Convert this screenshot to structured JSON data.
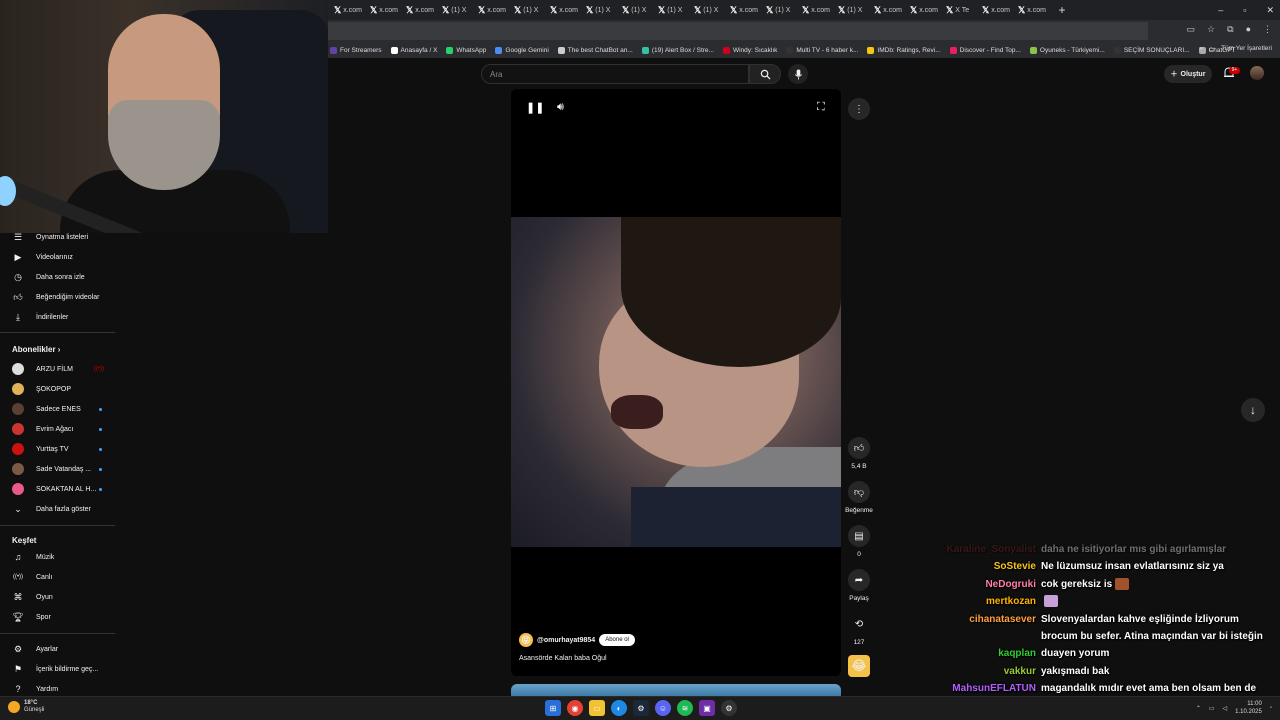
{
  "browser": {
    "tabs": [
      "x.com",
      "x.com",
      "x.com",
      "(1) X",
      "x.com",
      "(1) X",
      "x.com",
      "(1) X",
      "(1) X",
      "(1) X",
      "(1) X",
      "x.com",
      "(1) X",
      "x.com",
      "(1) X",
      "x.com",
      "x.com",
      "X Te",
      "x.com",
      "x.com"
    ],
    "new_tab": "+",
    "bookmarks": [
      {
        "label": "For Streamers",
        "color": "#6441a5"
      },
      {
        "label": "Anasayfa / X",
        "color": "#ffffff"
      },
      {
        "label": "WhatsApp",
        "color": "#25d366"
      },
      {
        "label": "Google Gemini",
        "color": "#4d8bf5"
      },
      {
        "label": "The best ChatBot an...",
        "color": "#cccccc"
      },
      {
        "label": "(19) Alert Box / Stre...",
        "color": "#31c3a2"
      },
      {
        "label": "Windy: Sıcaklık",
        "color": "#d0021b"
      },
      {
        "label": "Multi TV - 6 haber k...",
        "color": "#333333"
      },
      {
        "label": "IMDb: Ratings, Revi...",
        "color": "#f5c518"
      },
      {
        "label": "Discover - Find Top...",
        "color": "#e91e63"
      },
      {
        "label": "Oyuneks - Türkiyemi...",
        "color": "#8bc34a"
      },
      {
        "label": "SEÇİM SONUÇLARI...",
        "color": "#333333"
      },
      {
        "label": "ChatGPT",
        "color": "#aaaaaa"
      }
    ],
    "bookmarks_overflow": "»",
    "all_bookmarks": "Tüm Yer İşaretleri"
  },
  "sidebar": {
    "you_items": [
      {
        "label": "Oynatma listeleri",
        "icon": "playlist-icon"
      },
      {
        "label": "Videolarınız",
        "icon": "video-icon"
      },
      {
        "label": "Daha sonra izle",
        "icon": "clock-icon"
      },
      {
        "label": "Beğendiğim videolar",
        "icon": "thumbs-up-icon"
      },
      {
        "label": "İndirilenler",
        "icon": "download-icon"
      }
    ],
    "subs_title": "Abonelikler",
    "subscriptions": [
      {
        "label": "ARZU FİLM",
        "color": "#dddddd",
        "indicator": "live"
      },
      {
        "label": "ŞOKOPOP",
        "color": "#e0b25a",
        "indicator": "none"
      },
      {
        "label": "Sadece ENES",
        "color": "#5a4030",
        "indicator": "dot"
      },
      {
        "label": "Evrim Ağacı",
        "color": "#cc3333",
        "indicator": "dot"
      },
      {
        "label": "Yurttaş TV",
        "color": "#cc1111",
        "indicator": "dot"
      },
      {
        "label": "Sade Vatandaş ...",
        "color": "#7a5a44",
        "indicator": "dot"
      },
      {
        "label": "SOKAKTAN AL H...",
        "color": "#e85a8a",
        "indicator": "dot"
      }
    ],
    "show_more": "Daha fazla göster",
    "explore_title": "Keşfet",
    "explore_items": [
      {
        "label": "Müzik",
        "icon": "music-icon"
      },
      {
        "label": "Canlı",
        "icon": "live-icon"
      },
      {
        "label": "Oyun",
        "icon": "gamepad-icon"
      },
      {
        "label": "Spor",
        "icon": "trophy-icon"
      }
    ],
    "settings_items": [
      {
        "label": "Ayarlar",
        "icon": "gear-icon"
      },
      {
        "label": "İçerik bildirme geç...",
        "icon": "flag-icon"
      },
      {
        "label": "Yardım",
        "icon": "help-icon"
      }
    ]
  },
  "header": {
    "search_placeholder": "Ara",
    "create_label": "Oluştur",
    "notif_badge": "9+"
  },
  "short": {
    "channel": "@omurhayat9854",
    "subscribe_label": "Abone ol",
    "caption": "Asansörde Kalan baba Oğul",
    "like_count": "5,4 B",
    "dislike_label": "Beğenme",
    "comment_count": "0",
    "share_label": "Paylaş",
    "remix_count": "127"
  },
  "chat": [
    {
      "user": "Karaline_Sonyalist",
      "color": "#5a1e1e",
      "msg": "daha ne isitiyorlar mıs gibi agırlamışlar",
      "faded": true
    },
    {
      "user": "SoStevie",
      "color": "#f5c518",
      "msg": "Ne lüzumsuz insan evlatlarısınız siz ya"
    },
    {
      "user": "NeDogruki",
      "color": "#ff7fa8",
      "msg": "cok gereksiz is",
      "emote": "#a0522d"
    },
    {
      "user": "mertkozan",
      "color": "#ffb300",
      "msg": "",
      "emote": "#c7a0d9"
    },
    {
      "user": "cihanatasever",
      "color": "#ffa040",
      "msg": "Slovenyalardan kahve eşliğinde İzliyorum brocum bu sefer. Atina maçından var bi isteğin"
    },
    {
      "user": "kaqplan",
      "color": "#32cd32",
      "msg": "duayen yorum"
    },
    {
      "user": "vakkur",
      "color": "#9acd32",
      "msg": "yakışmadı bak"
    },
    {
      "user": "MahsunEFLATUN",
      "color": "#b060ff",
      "msg": "magandalık mıdır evet ama ben olsam ben de yapardım xdd"
    }
  ],
  "taskbar": {
    "temp": "18°C",
    "weather_label": "Güneşli",
    "time": "11:00",
    "date": "1.10.2025"
  }
}
